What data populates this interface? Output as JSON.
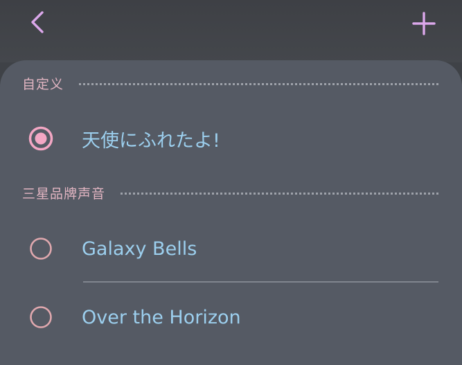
{
  "header": {
    "back_icon": "chevron-left-icon",
    "add_icon": "plus-icon",
    "accent_color": "#dba7ea"
  },
  "sections": [
    {
      "title": "自定义",
      "items": [
        {
          "label": "天使にふれたよ!",
          "selected": true
        }
      ]
    },
    {
      "title": "三星品牌声音",
      "items": [
        {
          "label": "Galaxy Bells",
          "selected": false
        },
        {
          "label": "Over the Horizon",
          "selected": false
        }
      ]
    }
  ],
  "colors": {
    "section_title": "#e2b5c2",
    "item_label": "#9ccfee",
    "radio": "#f3a7c4",
    "radio_unselected": "#e0a8ae"
  }
}
